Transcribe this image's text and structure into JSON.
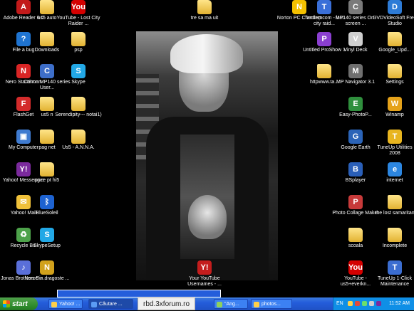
{
  "desktop": {
    "icons": [
      {
        "label": "Adobe Reader 6.0",
        "glyph": "A",
        "color": "#c21a1a"
      },
      {
        "label": "us5 auto",
        "glyph": "",
        "color": "folder"
      },
      {
        "label": "YouTube - Lost City Raider ...",
        "glyph": "You",
        "color": "#d40000"
      },
      {
        "label": "tre sa ma uit",
        "glyph": "",
        "color": "folder"
      },
      {
        "label": "Norton PC Checkup",
        "glyph": "N",
        "color": "#f3c000"
      },
      {
        "label": "Tandemcom - lost city raid...",
        "glyph": "T",
        "color": "#3a6fd8"
      },
      {
        "label": "MP140 series On-screen ...",
        "glyph": "C",
        "color": "#7a7a7a"
      },
      {
        "label": "DVDVideoSoft Free Studio",
        "glyph": "D",
        "color": "#2d7bd6"
      },
      {
        "label": "File a bug",
        "glyph": "?",
        "color": "#1f74d1"
      },
      {
        "label": "Downloads",
        "glyph": "",
        "color": "folder"
      },
      {
        "label": "psp",
        "glyph": "",
        "color": "folder"
      },
      {
        "label": "Untitled ProShow 1",
        "glyph": "P",
        "color": "#8b3fd1"
      },
      {
        "label": "Vinyl Deck",
        "glyph": "V",
        "color": "#cfcfcf"
      },
      {
        "label": "Google_Upd...",
        "glyph": "",
        "color": "folder"
      },
      {
        "label": "Nero StartSmart",
        "glyph": "N",
        "color": "#d92525"
      },
      {
        "label": "Canon MP140 series User...",
        "glyph": "C",
        "color": "#3d6ec9"
      },
      {
        "label": "Skype",
        "glyph": "S",
        "color": "#22a8e6"
      },
      {
        "label": "httpwww.ta...",
        "glyph": "",
        "color": "folder"
      },
      {
        "label": "MP Navigator 3.1",
        "glyph": "M",
        "color": "#6f6f6f"
      },
      {
        "label": "Settings",
        "glyph": "",
        "color": "folder"
      },
      {
        "label": "FlashGet",
        "glyph": "F",
        "color": "#d42b2b"
      },
      {
        "label": "us5 n",
        "glyph": "",
        "color": "folder"
      },
      {
        "label": "Serendipity--- notai1)",
        "glyph": "",
        "color": "folder"
      },
      {
        "label": "Easy-PhotoP...",
        "glyph": "E",
        "color": "#2f8f3d"
      },
      {
        "label": "Winamp",
        "glyph": "W",
        "color": "#e5a21a"
      },
      {
        "label": "My Computer",
        "glyph": "▣",
        "color": "#3f7bd0"
      },
      {
        "label": "pag net",
        "glyph": "",
        "color": "folder"
      },
      {
        "label": "Us5 - A.N.N.A.",
        "glyph": "",
        "color": "folder"
      },
      {
        "label": "Google Earth",
        "glyph": "G",
        "color": "#2b64b8"
      },
      {
        "label": "TuneUp Utilities 2008",
        "glyph": "T",
        "color": "#e8b51f"
      },
      {
        "label": "Yahoo! Messenger",
        "glyph": "Y!",
        "color": "#7b2a9d"
      },
      {
        "label": "poze pt hi5",
        "glyph": "",
        "color": "folder"
      },
      {
        "label": "BSplayer",
        "glyph": "B",
        "color": "#2a5fb8"
      },
      {
        "label": "internet",
        "glyph": "e",
        "color": "#2c86e0"
      },
      {
        "label": "Yahoo! Mail",
        "glyph": "✉",
        "color": "#f0c13a"
      },
      {
        "label": "BlueSoleil",
        "glyph": "ᛒ",
        "color": "#1d62d0"
      },
      {
        "label": "Photo Collage Maker",
        "glyph": "P",
        "color": "#c73a3a"
      },
      {
        "label": "the lost samaritan",
        "glyph": "",
        "color": "folder"
      },
      {
        "label": "Recycle Bin",
        "glyph": "♻",
        "color": "#4da24a"
      },
      {
        "label": "SkypeSetup",
        "glyph": "S",
        "color": "#22a8e6"
      },
      {
        "label": "scoala",
        "glyph": "",
        "color": "folder"
      },
      {
        "label": "Incomplete",
        "glyph": "",
        "color": "folder"
      },
      {
        "label": "Jonas Brothers-Bu...",
        "glyph": "♪",
        "color": "#5a6fd9"
      },
      {
        "label": "Norce in dragoste ...",
        "glyph": "N",
        "color": "#d1a11c"
      },
      {
        "label": "Your YouTube Usernames - ...",
        "glyph": "Y!",
        "color": "#c41d1d"
      },
      {
        "label": "YouTube - us5+everkn...",
        "glyph": "You",
        "color": "#d40000"
      },
      {
        "label": "TuneUp 1-Click Maintenance",
        "glyph": "T",
        "color": "#3b6dd0"
      }
    ]
  },
  "taskbar": {
    "start_label": "start",
    "tasks": [
      {
        "label": "Yahoo! ..."
      },
      {
        "label": "Căutare ..."
      },
      {
        "label": "\"Ang..."
      },
      {
        "label": "photos..."
      }
    ],
    "tray": {
      "lang": "EN",
      "clock": "11:52 AM"
    }
  },
  "watermark": {
    "text": "rbd.3xforum.ro"
  }
}
